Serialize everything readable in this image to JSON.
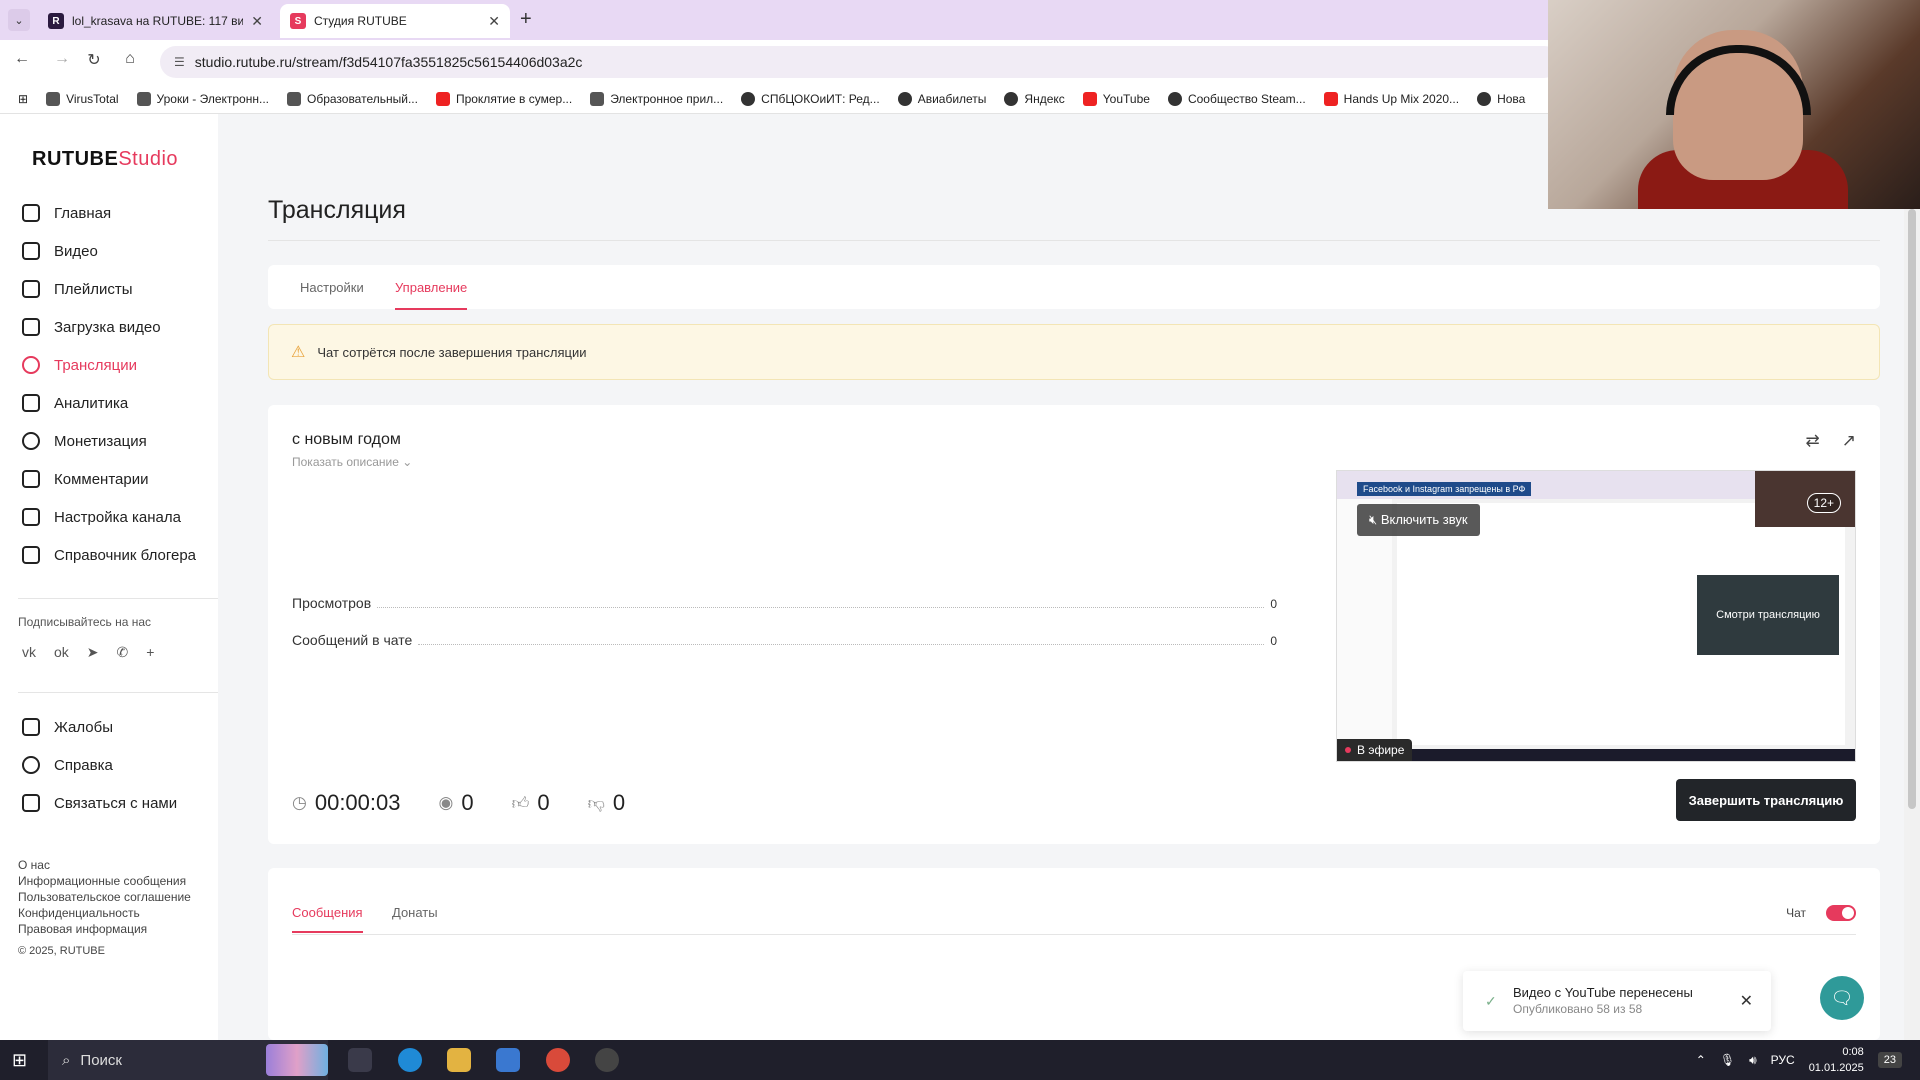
{
  "browser": {
    "tabs": [
      {
        "title": "lol_krasava на RUTUBE: 117 ви",
        "favicon": "R"
      },
      {
        "title": "Студия RUTUBE",
        "favicon": "S"
      }
    ],
    "url": "studio.rutube.ru/stream/f3d54107fa3551825c56154406d03a2c",
    "bookmarks": [
      "VirusTotal",
      "Уроки - Электронн...",
      "Образовательный...",
      "Проклятие в сумер...",
      "Электронное прил...",
      "СПбЦОКОиИТ: Ред...",
      "Авиабилеты",
      "Яндекс",
      "YouTube",
      "Сообщество Steam...",
      "Hands Up Mix 2020...",
      "Нова"
    ]
  },
  "sidebar": {
    "logo_main": "RUTUBE",
    "logo_studio": "Studio",
    "items": [
      {
        "label": "Главная",
        "icon": "home-icon"
      },
      {
        "label": "Видео",
        "icon": "video-icon"
      },
      {
        "label": "Плейлисты",
        "icon": "playlist-icon"
      },
      {
        "label": "Загрузка видео",
        "icon": "upload-icon"
      },
      {
        "label": "Трансляции",
        "icon": "broadcast-icon",
        "active": true
      },
      {
        "label": "Аналитика",
        "icon": "analytics-icon"
      },
      {
        "label": "Монетизация",
        "icon": "monetization-icon"
      },
      {
        "label": "Комментарии",
        "icon": "comments-icon"
      },
      {
        "label": "Настройка канала",
        "icon": "channel-settings-icon"
      },
      {
        "label": "Справочник блогера",
        "icon": "handbook-icon"
      }
    ],
    "follow_label": "Подписывайтесь на нас",
    "socials": [
      "vk-icon",
      "ok-icon",
      "telegram-icon",
      "viber-icon",
      "more-icon"
    ],
    "secondary": [
      {
        "label": "Жалобы",
        "icon": "flag-icon"
      },
      {
        "label": "Справка",
        "icon": "help-icon"
      },
      {
        "label": "Связаться с нами",
        "icon": "mail-icon"
      }
    ],
    "footer_links": [
      "О нас",
      "Информационные сообщения",
      "Пользовательское соглашение",
      "Конфиденциальность",
      "Правовая информация"
    ],
    "copyright": "© 2025, RUTUBE"
  },
  "main": {
    "page_title": "Трансляция",
    "tabs": [
      {
        "label": "Настройки"
      },
      {
        "label": "Управление",
        "active": true
      }
    ],
    "alert": "Чат сотрётся после завершения трансляции",
    "stream": {
      "title": "с новым годом",
      "show_description": "Показать описание",
      "stats": [
        {
          "label": "Просмотров",
          "value": "0"
        },
        {
          "label": "Сообщений в чате",
          "value": "0"
        }
      ],
      "preview": {
        "banner": "Facebook и Instagram запрещены в РФ",
        "unmute": "Включить звук",
        "age": "12+",
        "live": "В эфире",
        "inner_label": "Смотри трансляцию"
      },
      "metrics": {
        "duration": "00:00:03",
        "viewers": "0",
        "likes": "0",
        "dislikes": "0"
      },
      "end_button": "Завершить трансляцию"
    },
    "chat": {
      "tabs": [
        {
          "label": "Сообщения",
          "active": true
        },
        {
          "label": "Донаты"
        }
      ],
      "toggle_label": "Чат",
      "toggle_on": true
    }
  },
  "toast": {
    "title": "Видео с YouTube перенесены",
    "subtitle": "Опубликовано 58 из 58"
  },
  "taskbar": {
    "search_placeholder": "Поиск",
    "language": "РУС",
    "time": "0:08",
    "date": "01.01.2025",
    "notifications": "23"
  },
  "colors": {
    "accent": "#e63a5d",
    "dark_button": "#222529",
    "alert_bg": "#fdf7e4"
  }
}
